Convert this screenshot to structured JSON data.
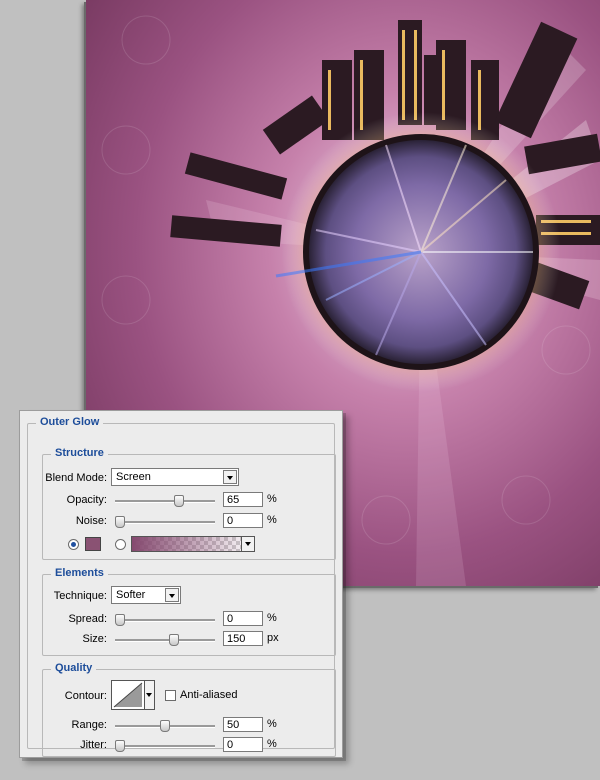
{
  "colors": {
    "canvas_bg": "#8d4a74",
    "glow": "#85496f",
    "group_title": "#1d4d9a"
  },
  "panel": {
    "title": "Outer Glow",
    "structure": {
      "title": "Structure",
      "blend_mode": {
        "label": "Blend Mode:",
        "value": "Screen"
      },
      "opacity": {
        "label": "Opacity:",
        "value": "65",
        "unit": "%",
        "level": 0.65
      },
      "noise": {
        "label": "Noise:",
        "value": "0",
        "unit": "%",
        "level": 0
      },
      "color_swatch": "#8a5273"
    },
    "elements": {
      "title": "Elements",
      "technique": {
        "label": "Technique:",
        "value": "Softer"
      },
      "spread": {
        "label": "Spread:",
        "value": "0",
        "unit": "%",
        "level": 0
      },
      "size": {
        "label": "Size:",
        "value": "150",
        "unit": "px",
        "level": 0.6
      }
    },
    "quality": {
      "title": "Quality",
      "contour": {
        "label": "Contour:"
      },
      "anti_aliased": {
        "label": "Anti-aliased",
        "checked": false
      },
      "range": {
        "label": "Range:",
        "value": "50",
        "unit": "%",
        "level": 0.5
      },
      "jitter": {
        "label": "Jitter:",
        "value": "0",
        "unit": "%",
        "level": 0
      }
    }
  }
}
